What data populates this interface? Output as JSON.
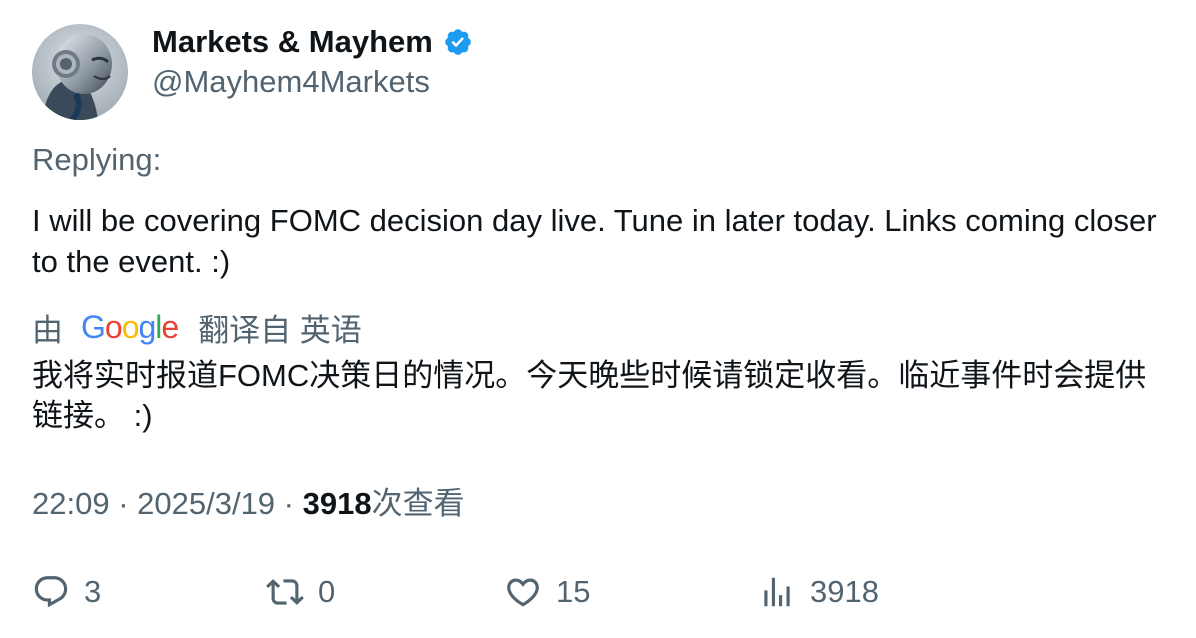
{
  "author": {
    "display_name": "Markets & Mayhem",
    "handle": "@Mayhem4Markets",
    "avatar_icon": "robot-avatar",
    "verified_icon": "verified-badge-icon",
    "verified_color": "#1d9bf0"
  },
  "replying_label": "Replying:",
  "tweet_text": "I will be covering FOMC decision day live. Tune in later today. Links coming closer to the event. :)",
  "translation": {
    "by_label": "由",
    "provider": "Google",
    "from_label": "翻译自 英语",
    "text": "我将实时报道FOMC决策日的情况。今天晚些时候请锁定收看。临近事件时会提供链接。 :)"
  },
  "meta": {
    "time": "22:09",
    "separator": " · ",
    "date": "2025/3/19",
    "views_count": "3918",
    "views_label": "次查看"
  },
  "actions": {
    "replies": "3",
    "reposts": "0",
    "likes": "15",
    "views": "3918"
  },
  "colors": {
    "primary_text": "#0f1419",
    "secondary_text": "#536471",
    "accent": "#1d9bf0"
  }
}
